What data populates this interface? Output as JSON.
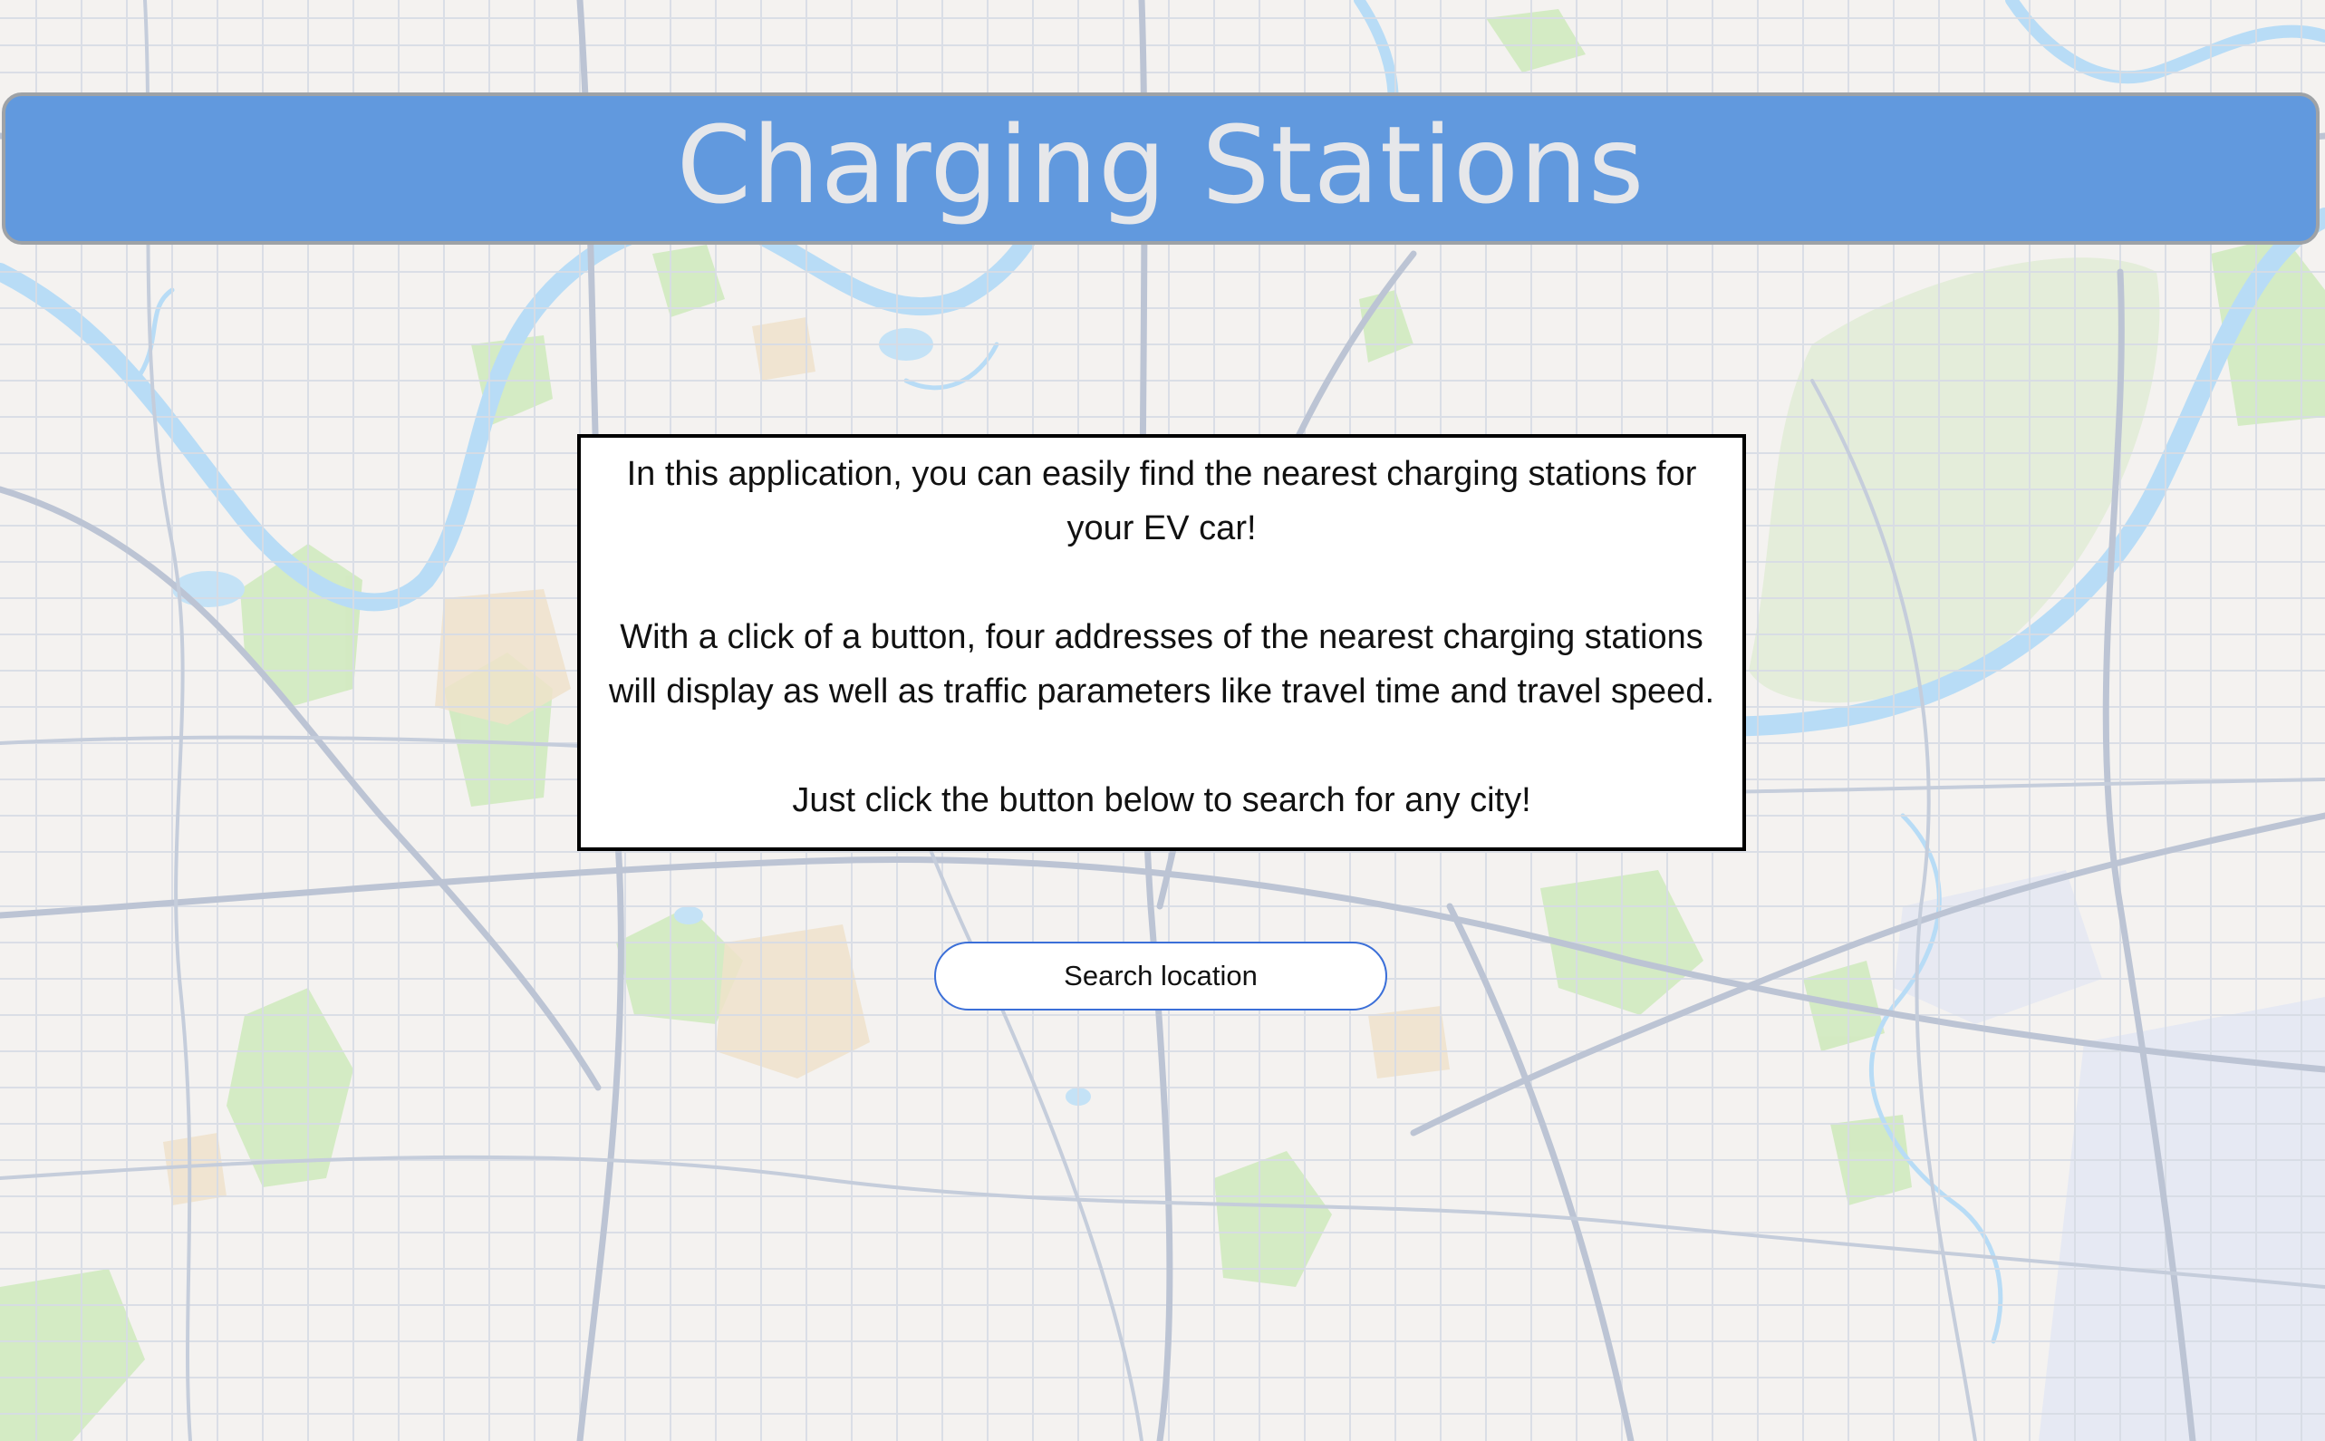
{
  "header": {
    "title": "Charging Stations"
  },
  "intro": {
    "paragraph_1": "In this application, you can easily find the nearest charging stations for your EV car!",
    "paragraph_2": "With a click of a button, four addresses of the nearest charging stations will display as well as traffic parameters like travel time and travel speed.",
    "paragraph_3": "Just click the button below to search for any city!"
  },
  "search": {
    "button_label": "Search location"
  },
  "colors": {
    "header_bg": "#6199de",
    "header_text": "#e6e7ea",
    "button_border": "#3b6fd8",
    "map_water": "#a7d3f2",
    "map_park": "#bfe3a6",
    "map_road": "#aab5c8"
  },
  "icons": {
    "background": "city-map-background"
  }
}
